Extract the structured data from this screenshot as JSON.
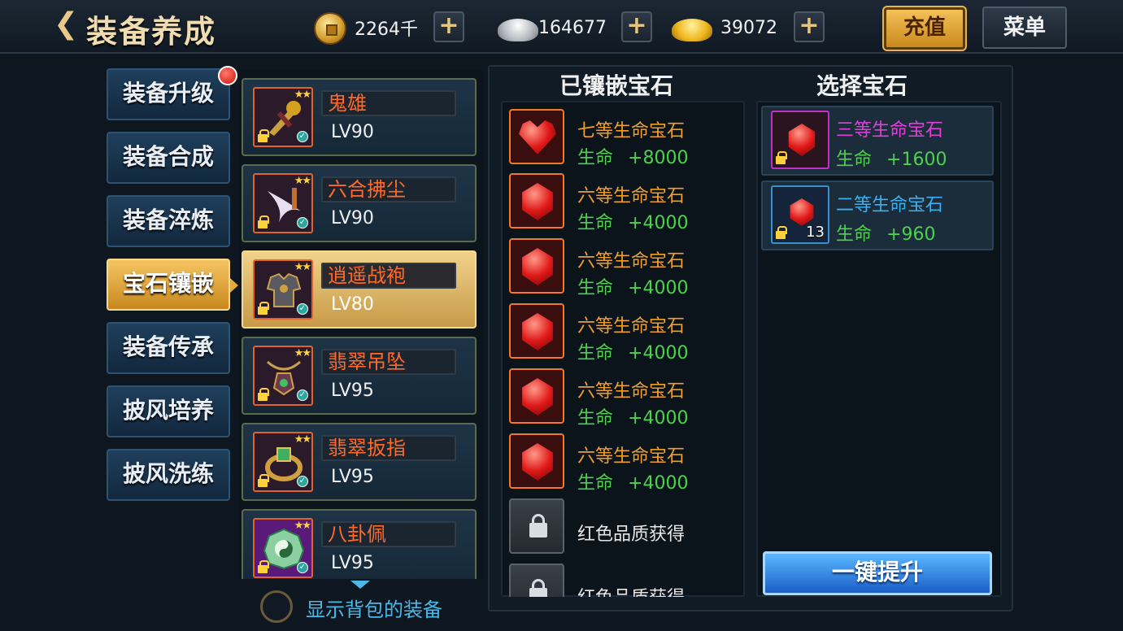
{
  "header": {
    "title": "装备养成",
    "currencies": [
      {
        "icon": "copper-coin-icon",
        "value": "2264千"
      },
      {
        "icon": "silver-ingot-icon",
        "value": "164677"
      },
      {
        "icon": "gold-ingot-icon",
        "value": "39072"
      }
    ],
    "plus_label": "+",
    "recharge_label": "充值",
    "menu_label": "菜单"
  },
  "tabs": [
    {
      "label": "装备升级",
      "active": false,
      "badge": true
    },
    {
      "label": "装备合成",
      "active": false
    },
    {
      "label": "装备淬炼",
      "active": false
    },
    {
      "label": "宝石镶嵌",
      "active": true
    },
    {
      "label": "装备传承",
      "active": false
    },
    {
      "label": "披风培养",
      "active": false
    },
    {
      "label": "披风洗练",
      "active": false
    }
  ],
  "equipment": [
    {
      "name": "鬼雄",
      "level": "LV90",
      "icon": "weapon-icon",
      "selected": false
    },
    {
      "name": "六合拂尘",
      "level": "LV90",
      "icon": "whisk-icon",
      "selected": false
    },
    {
      "name": "逍遥战袍",
      "level": "LV80",
      "icon": "armor-icon",
      "selected": true
    },
    {
      "name": "翡翠吊坠",
      "level": "LV95",
      "icon": "pendant-icon",
      "selected": false
    },
    {
      "name": "翡翠扳指",
      "level": "LV95",
      "icon": "ring-icon",
      "selected": false
    },
    {
      "name": "八卦佩",
      "level": "LV95",
      "icon": "bagua-icon",
      "selected": false
    }
  ],
  "show_bag_label": "显示背包的装备",
  "inlaid": {
    "title": "已镶嵌宝石",
    "gems": [
      {
        "name": "七等生命宝石",
        "stat": "生命",
        "value": "+8000",
        "icon": "heart-gem-icon"
      },
      {
        "name": "六等生命宝石",
        "stat": "生命",
        "value": "+4000",
        "icon": "red-gem-icon"
      },
      {
        "name": "六等生命宝石",
        "stat": "生命",
        "value": "+4000",
        "icon": "red-gem-icon"
      },
      {
        "name": "六等生命宝石",
        "stat": "生命",
        "value": "+4000",
        "icon": "red-gem-icon"
      },
      {
        "name": "六等生命宝石",
        "stat": "生命",
        "value": "+4000",
        "icon": "red-gem-icon"
      },
      {
        "name": "六等生命宝石",
        "stat": "生命",
        "value": "+4000",
        "icon": "red-gem-icon"
      }
    ],
    "locked_slots": [
      "红色品质获得",
      "红色品质获得"
    ]
  },
  "select": {
    "title": "选择宝石",
    "gems": [
      {
        "name": "三等生命宝石",
        "stat": "生命",
        "value": "+1600",
        "count": "",
        "name_color": "#e040d8",
        "border_color": "#c030c8"
      },
      {
        "name": "二等生命宝石",
        "stat": "生命",
        "value": "+960",
        "count": "13",
        "name_color": "#3ab0f0",
        "border_color": "#3a90d0"
      }
    ]
  },
  "upgrade_label": "一键提升"
}
